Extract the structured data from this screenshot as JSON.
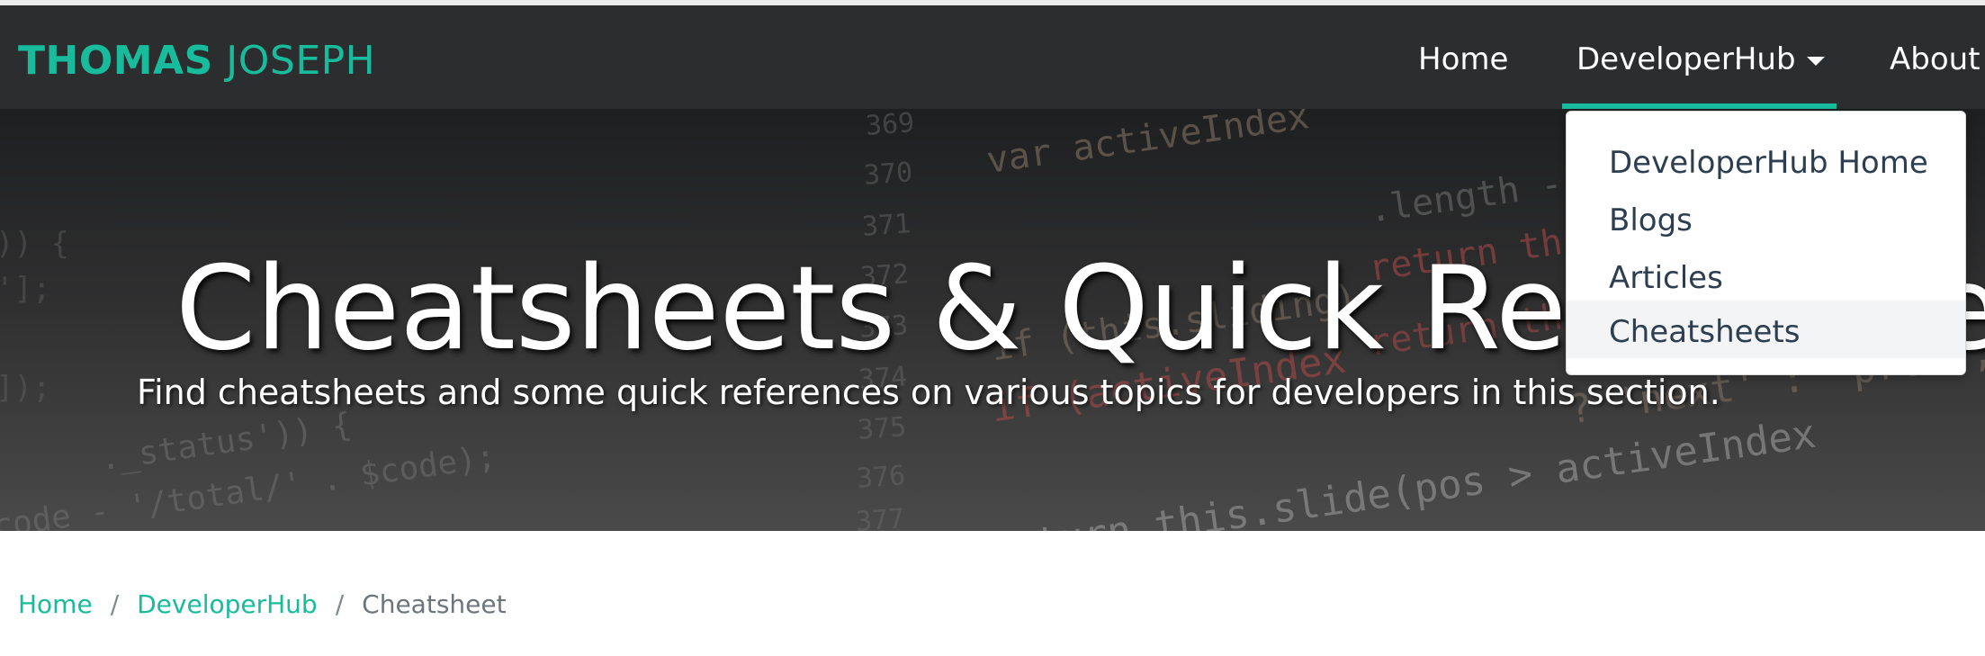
{
  "navbar": {
    "brand": {
      "first": "THOMAS",
      "last": "JOSEPH"
    },
    "items": [
      {
        "label": "Home"
      },
      {
        "label": "DeveloperHub"
      },
      {
        "label": "About"
      }
    ]
  },
  "dropdown": {
    "items": [
      {
        "label": "DeveloperHub Home"
      },
      {
        "label": "Blogs"
      },
      {
        "label": "Articles"
      },
      {
        "label": "Cheatsheets"
      }
    ]
  },
  "hero": {
    "title": "Cheatsheets & Quick References",
    "subtitle": "Find cheatsheets and some quick references on various topics for developers in this section."
  },
  "breadcrumb": {
    "items": [
      {
        "label": "Home"
      },
      {
        "label": "DeveloperHub"
      },
      {
        "label": "Cheatsheet"
      }
    ],
    "separator": "/"
  },
  "colors": {
    "accent": "#18bc9c",
    "navbar_bg": "#2c2d2f",
    "dropdown_text": "#2c3e50"
  },
  "background_code": [
    {
      "text": "var activeIndex",
      "color": "#8a7a6a"
    },
    {
      "text": "369",
      "color": "#6d6d6d"
    },
    {
      "text": "370",
      "color": "#6d6d6d"
    },
    {
      "text": "371",
      "color": "#6d6d6d"
    },
    {
      "text": "372",
      "color": "#6d6d6d"
    },
    {
      "text": "373",
      "color": "#6d6d6d"
    },
    {
      "text": "374",
      "color": "#6d6d6d"
    },
    {
      "text": "375",
      "color": "#6d6d6d"
    },
    {
      "text": "376",
      "color": "#6d6d6d"
    },
    {
      "text": "377",
      "color": "#6d6d6d"
    },
    {
      "text": "378",
      "color": "#6d6d6d"
    },
    {
      "text": ".length - 1)",
      "color": "#7a7a7a"
    },
    {
      "text": "return this.",
      "color": "#b24a4a"
    },
    {
      "text": "if (this.sliding)",
      "color": "#8a7a6a"
    },
    {
      "text": "return this.",
      "color": "#b24a4a"
    },
    {
      "text": "if (activeIndex",
      "color": "#b24a4a"
    },
    {
      "text": "? 'next' : 'prev', this.$i",
      "color": "#8a7a6a"
    },
    {
      "text": "return this.slide(pos > activeIndex",
      "color": "#9a9a9a"
    },
    {
      "text": "._status')) {",
      "color": "#7a7a7a"
    },
    {
      "text": "code - '/total/' . $code);",
      "color": "#7a7a7a"
    },
    {
      "text": ")) {",
      "color": "#6a6a6a"
    },
    {
      "text": "'];",
      "color": "#6a6a6a"
    },
    {
      "text": "]);",
      "color": "#6a6a6a"
    }
  ]
}
